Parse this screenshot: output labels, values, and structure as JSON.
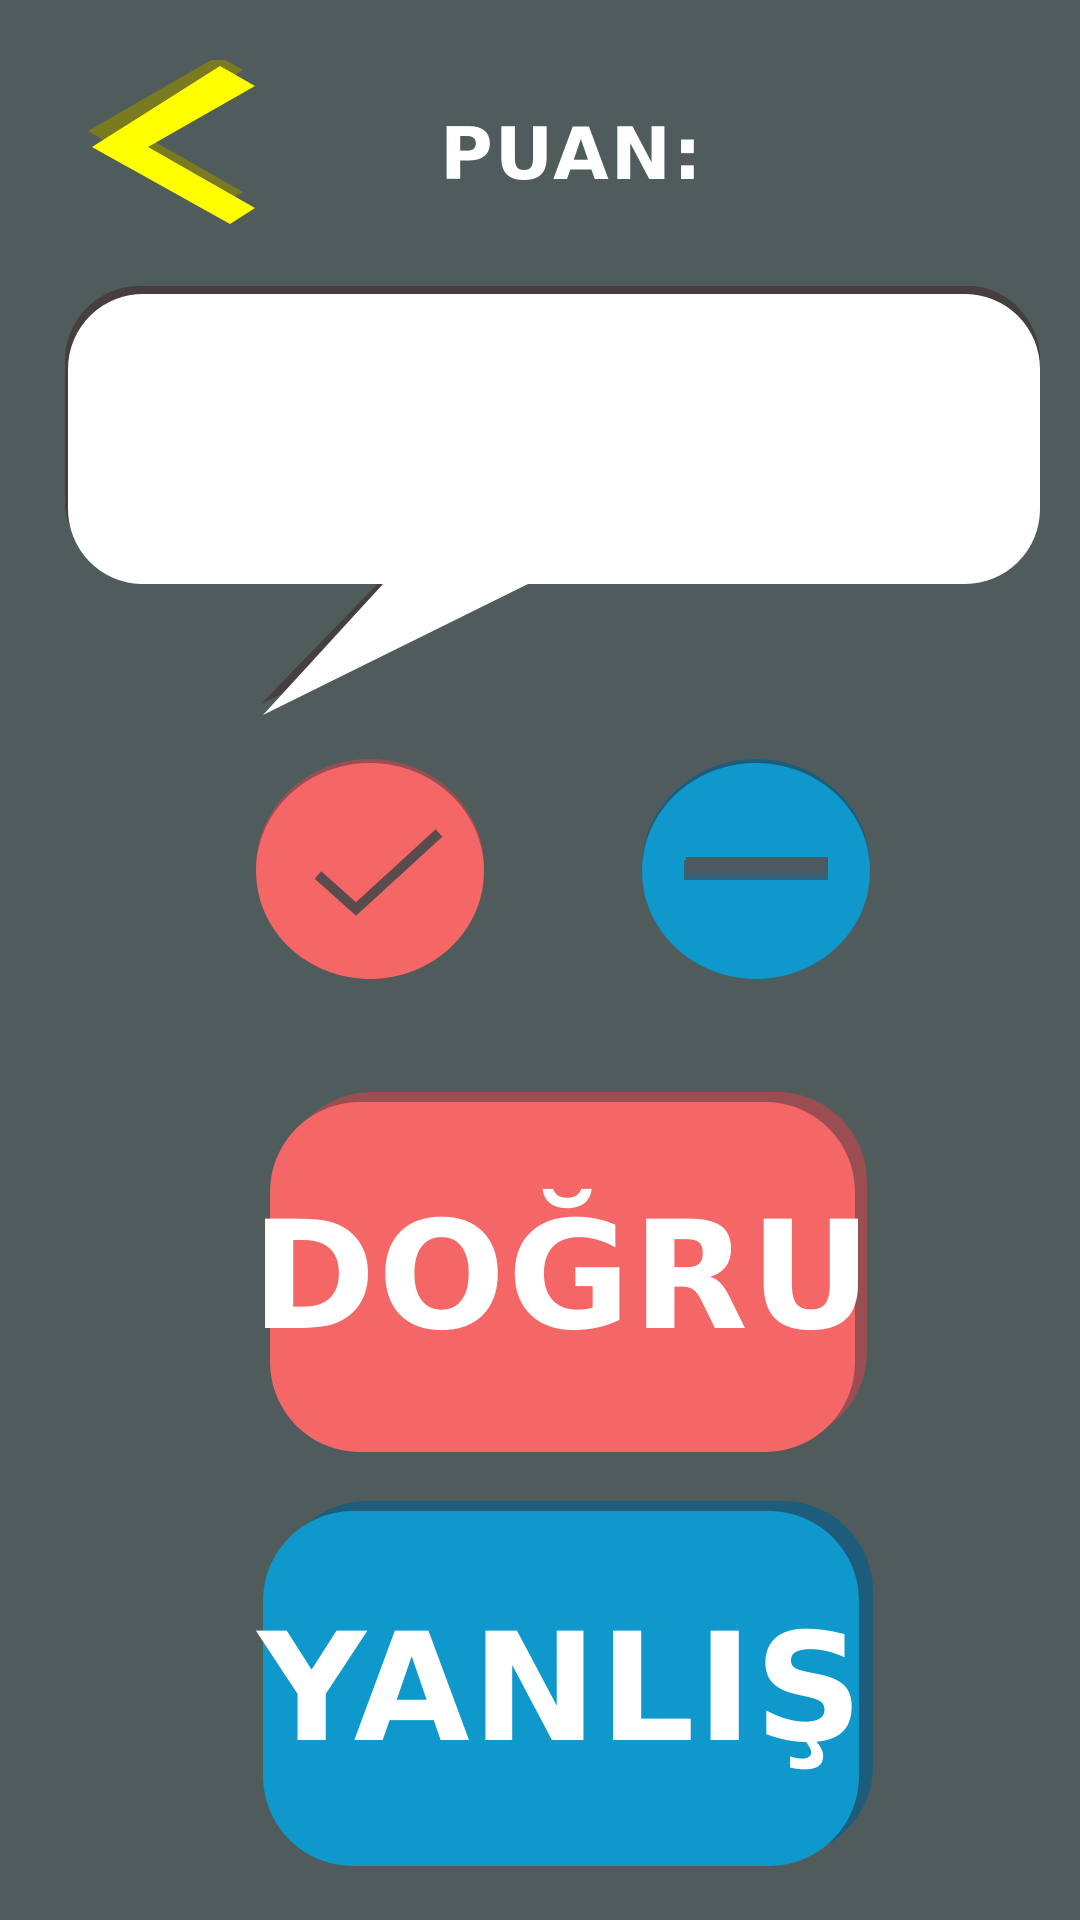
{
  "header": {
    "back_icon": "chevron-left-icon",
    "score_label": "PUAN:"
  },
  "question": {
    "text": ""
  },
  "indicators": {
    "correct_icon": "checkmark-icon",
    "wrong_icon": "minus-icon"
  },
  "answers": {
    "true_label": "DOĞRU",
    "false_label": "YANLIŞ"
  },
  "colors": {
    "background": "#505c5c",
    "accent_yellow": "#ffff00",
    "true_red": "#f56767",
    "false_blue": "#0e98cc",
    "text": "#ffffff"
  }
}
